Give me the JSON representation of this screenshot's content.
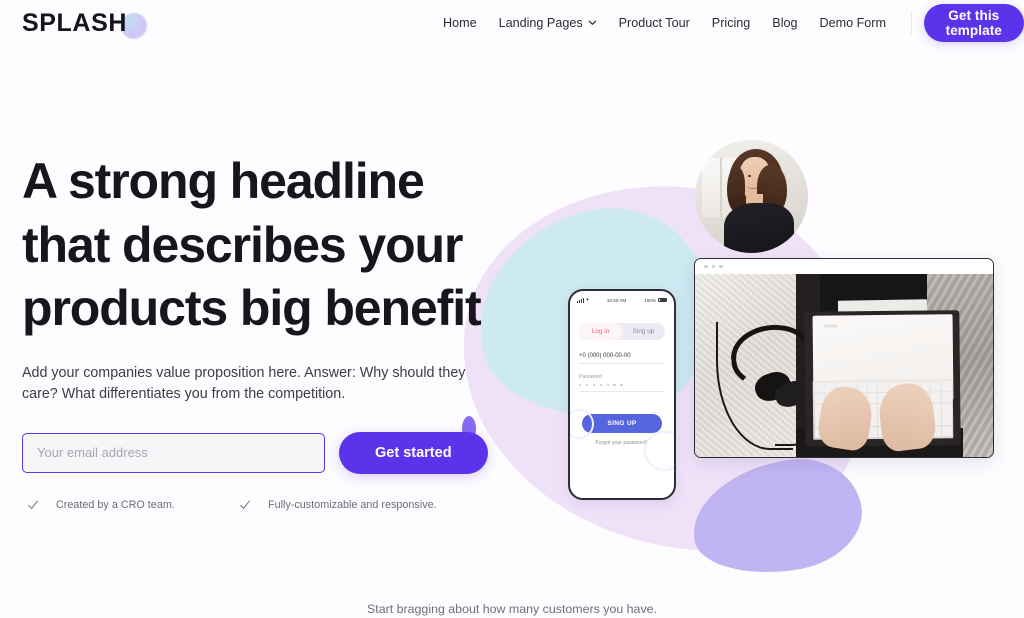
{
  "header": {
    "logo_text": "SPLASH",
    "logo_dot_icon": "blob-dot-icon",
    "nav_items": [
      {
        "label": "Home",
        "has_chevron": false
      },
      {
        "label": "Landing Pages",
        "has_chevron": true
      },
      {
        "label": "Product Tour",
        "has_chevron": false
      },
      {
        "label": "Pricing",
        "has_chevron": false
      },
      {
        "label": "Blog",
        "has_chevron": false
      },
      {
        "label": "Demo Form",
        "has_chevron": false
      }
    ],
    "cta_label": "Get this template"
  },
  "hero": {
    "headline_lines": [
      "A strong headline",
      "that describes your",
      "products big benefit"
    ],
    "subhead": "Add your companies value proposition here. Answer: Why should they care? What differentiates you from the competition.",
    "email_placeholder": "Your email address",
    "email_value": "",
    "cta_label": "Get started",
    "features": [
      {
        "check_icon": "checkmark-icon",
        "label": "Created by a CRO team."
      },
      {
        "check_icon": "checkmark-icon",
        "label": "Fully-customizable and responsive."
      }
    ]
  },
  "phone_mockup": {
    "status_time": "10:30 AM",
    "status_battery": "100%",
    "tab_login": "Log in",
    "tab_signup": "Sing up",
    "phone_field_value": "+0 (000) 000-00-00",
    "password_label": "Password",
    "password_dots": 7,
    "signup_button": "SING UP",
    "forgot_link": "Forgot your password?"
  },
  "browser_mockup": {
    "photo_alt": "Hands typing on a tablet keyboard beside black headphones on a fur rug",
    "dots": 3
  },
  "portrait": {
    "alt": "Smiling woman with brown hair wearing a black top"
  },
  "footer": {
    "note": "Start bragging about how many customers you have."
  },
  "colors": {
    "brand_purple": "#5a33ea",
    "phone_button_blue": "#5565de",
    "login_pink": "#ef5d7a",
    "blob_cyan": "#c7eaf0",
    "blob_lavender": "#eee0f8",
    "blob_periwinkle": "#c0b4f2",
    "page_background": "#fdfcfe",
    "text_dark": "#17161c",
    "text_muted": "#6d6c78"
  }
}
